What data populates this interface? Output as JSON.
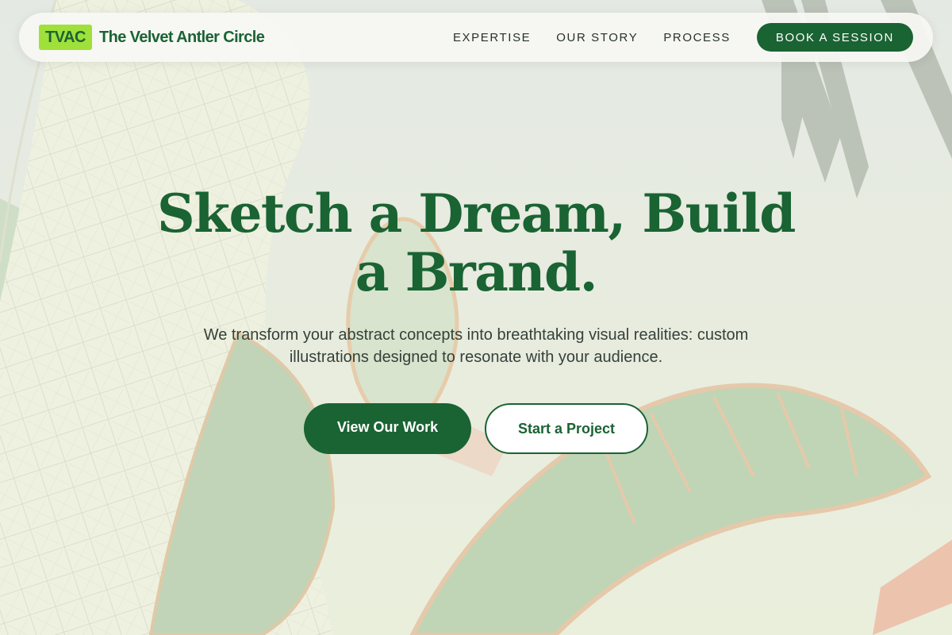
{
  "brand": {
    "badge": "TVAC",
    "name": "The Velvet Antler Circle"
  },
  "nav": {
    "links": [
      "EXPERTISE",
      "OUR STORY",
      "PROCESS"
    ],
    "cta": "BOOK A SESSION"
  },
  "hero": {
    "title": "Sketch a Dream, Build a Brand.",
    "subtitle": "We transform your abstract concepts into breathtaking visual realities: custom illustrations designed to resonate with your audience.",
    "primary_button": "View Our Work",
    "secondary_button": "Start a Project"
  },
  "colors": {
    "brand_green": "#1a6333",
    "badge_lime": "#9fe03a",
    "body_text": "#34413a"
  }
}
